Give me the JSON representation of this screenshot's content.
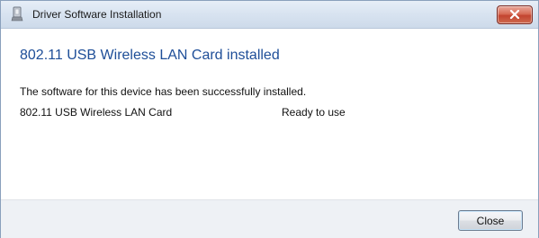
{
  "window": {
    "title": "Driver Software Installation"
  },
  "main": {
    "heading": "802.11 USB Wireless LAN Card installed",
    "message": "The software for this device has been successfully installed.",
    "devices": [
      {
        "name": "802.11 USB Wireless LAN Card",
        "status": "Ready to use"
      }
    ]
  },
  "footer": {
    "close_label": "Close"
  },
  "colors": {
    "heading": "#1e4e98",
    "close_x": "#c24430"
  },
  "icons": {
    "title": "driver-installation-icon",
    "close": "close-icon"
  }
}
